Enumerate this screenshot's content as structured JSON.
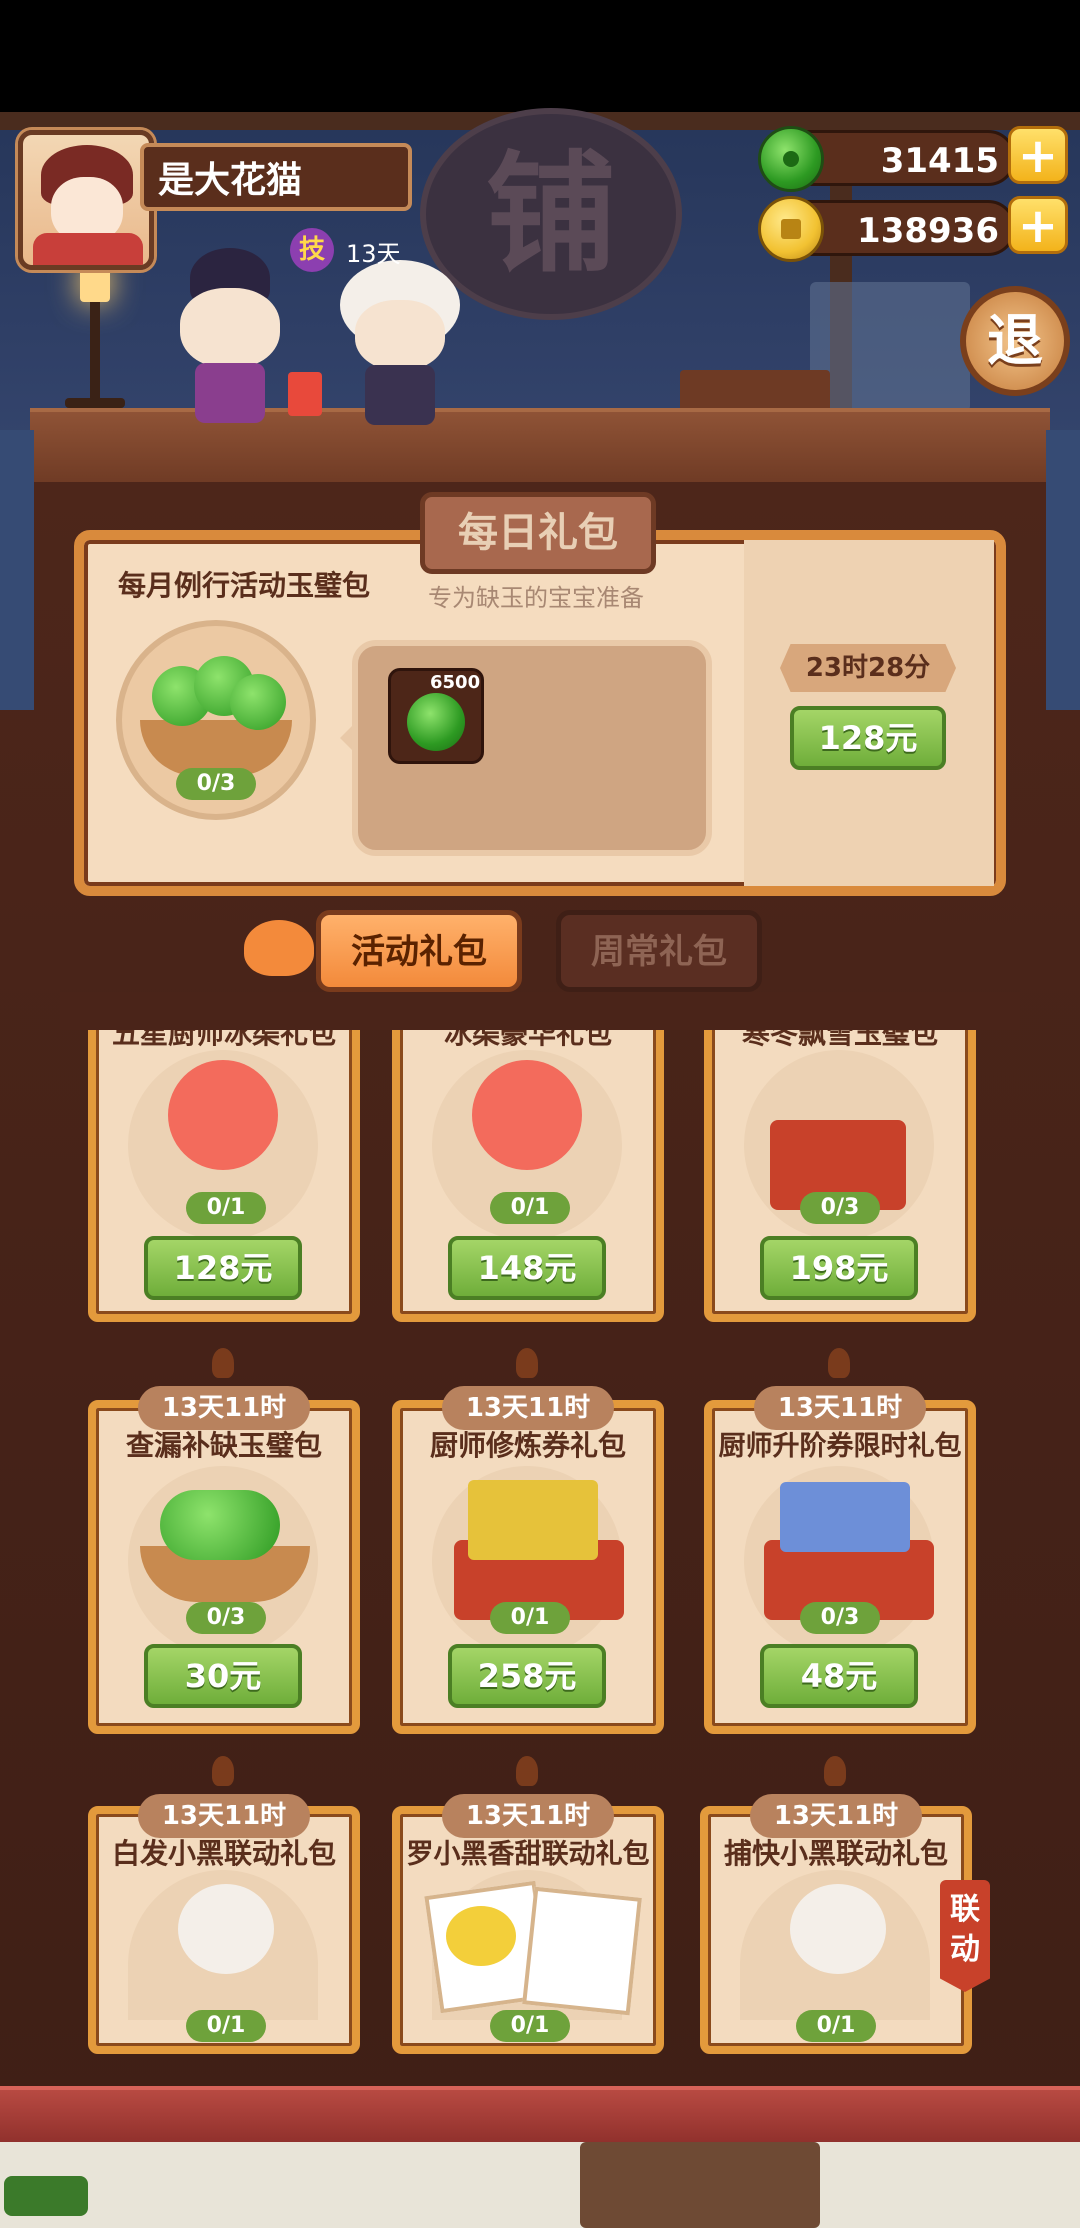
{
  "header": {
    "player_name": "是大花猫",
    "skill_badge": "技",
    "skill_days": "13天",
    "shop_sign": "铺",
    "jade_count": "31415",
    "coin_count": "138936",
    "exit_label": "退"
  },
  "daily_gift": {
    "tab_label": "每日礼包",
    "title": "每月例行活动玉璧包",
    "subtitle": "专为缺玉的宝宝准备",
    "progress": "0/3",
    "item_count": "6500",
    "timer": "23时28分",
    "price": "128元"
  },
  "tabs": {
    "activity": "活动礼包",
    "weekly": "周常礼包"
  },
  "gift_cards": [
    {
      "name": "五星厨师冰渠礼包",
      "progress": "0/1",
      "price": "128元"
    },
    {
      "name": "冰渠豪华礼包",
      "progress": "0/1",
      "price": "148元"
    },
    {
      "name": "寒冬飘雪玉璧包",
      "progress": "0/3",
      "price": "198元"
    },
    {
      "timer": "13天11时",
      "name": "查漏补缺玉璧包",
      "progress": "0/3",
      "price": "30元"
    },
    {
      "timer": "13天11时",
      "name": "厨师修炼券礼包",
      "progress": "0/1",
      "price": "258元"
    },
    {
      "timer": "13天11时",
      "name": "厨师升阶券限时礼包",
      "progress": "0/3",
      "price": "48元"
    },
    {
      "timer": "13天11时",
      "name": "白发小黑联动礼包",
      "progress": "0/1"
    },
    {
      "timer": "13天11时",
      "name": "罗小黑香甜联动礼包",
      "progress": "0/1"
    },
    {
      "timer": "13天11时",
      "name": "捕快小黑联动礼包",
      "progress": "0/1"
    }
  ],
  "collab_tag": "联动",
  "colors": {
    "jade_green": "#3fae2f",
    "coin_gold": "#f2c232",
    "button_green": "#79b843",
    "card_border": "#e39a3c",
    "wood_dark": "#4d261a"
  }
}
